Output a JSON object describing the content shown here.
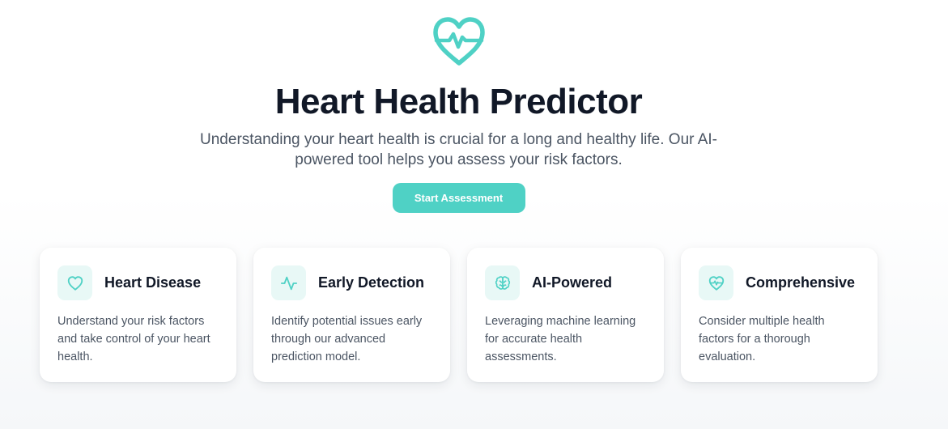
{
  "hero": {
    "logo_icon": "heart-pulse-icon",
    "title": "Heart Health Predictor",
    "subtitle": "Understanding your heart health is crucial for a long and healthy life. Our AI-powered tool helps you assess your risk factors.",
    "cta_label": "Start Assessment"
  },
  "features": [
    {
      "icon": "heart-icon",
      "title": "Heart Disease",
      "description": "Understand your risk factors and take control of your heart health."
    },
    {
      "icon": "activity-icon",
      "title": "Early Detection",
      "description": "Identify potential issues early through our advanced prediction model."
    },
    {
      "icon": "brain-icon",
      "title": "AI-Powered",
      "description": "Leveraging machine learning for accurate health assessments."
    },
    {
      "icon": "heart-pulse-icon",
      "title": "Comprehensive",
      "description": "Consider multiple health factors for a thorough evaluation."
    }
  ],
  "colors": {
    "accent": "#4fd1c5",
    "icon_bg": "#e8f8f6",
    "heading": "#111827",
    "body_text": "#4b5563"
  }
}
